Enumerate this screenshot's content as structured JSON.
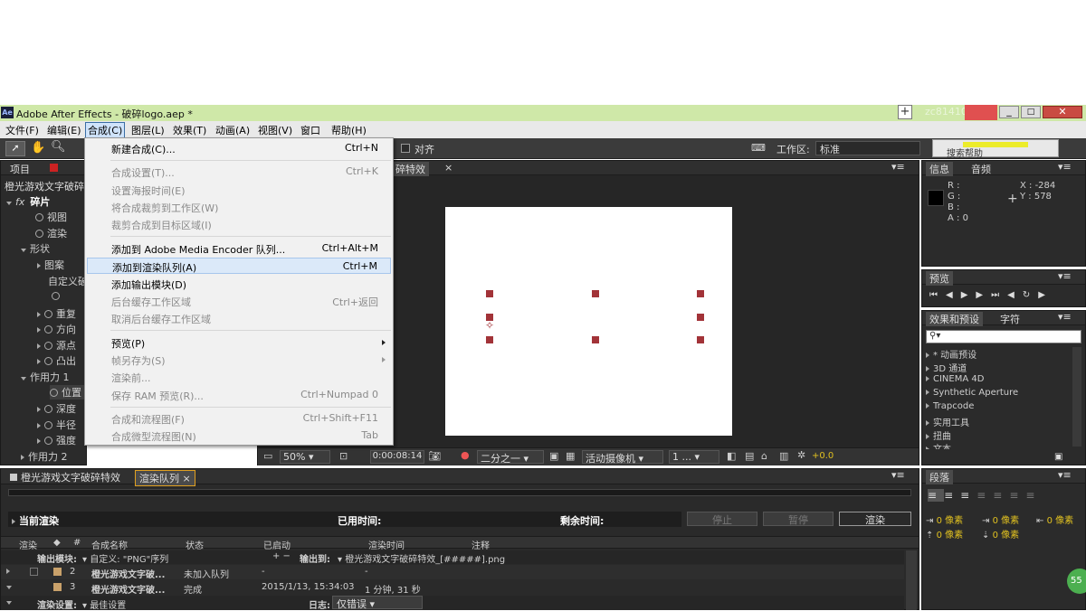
{
  "window": {
    "title": "Adobe After Effects - 破碎logo.aep *",
    "app_icon": "Ae"
  },
  "menubar": {
    "items": [
      "文件(F)",
      "编辑(E)",
      "合成(C)",
      "图层(L)",
      "效果(T)",
      "动画(A)",
      "视图(V)",
      "窗口",
      "帮助(H)"
    ]
  },
  "toolbar": {
    "align_label": "对齐",
    "workspace_label": "工作区:",
    "workspace_value": "标准",
    "search_help": "搜索帮助",
    "overlay_text": "zc81410"
  },
  "project_panel": {
    "tab": "项目",
    "comp_name": "橙光游戏文字破碎",
    "items": [
      {
        "label": "碎片",
        "kind": "fx"
      },
      {
        "label": "视图",
        "kind": "sw"
      },
      {
        "label": "渲染",
        "kind": "sw"
      },
      {
        "label": "形状",
        "kind": "open"
      },
      {
        "label": "图案",
        "kind": "sw"
      },
      {
        "label": "自定义破",
        "kind": "plain"
      },
      {
        "label": "",
        "kind": "sw"
      },
      {
        "label": "重复",
        "kind": "closed"
      },
      {
        "label": "方向",
        "kind": "closed"
      },
      {
        "label": "源点",
        "kind": "closed"
      },
      {
        "label": "凸出",
        "kind": "closed"
      },
      {
        "label": "作用力 1",
        "kind": "open"
      },
      {
        "label": "位置",
        "kind": "sw"
      },
      {
        "label": "深度",
        "kind": "closed"
      },
      {
        "label": "半径",
        "kind": "closed"
      },
      {
        "label": "强度",
        "kind": "closed"
      },
      {
        "label": "作用力 2",
        "kind": "closed"
      }
    ]
  },
  "menu": {
    "items": [
      {
        "label": "新建合成(C)...",
        "shortcut": "Ctrl+N",
        "enabled": true
      },
      {
        "sep": true
      },
      {
        "label": "合成设置(T)...",
        "shortcut": "Ctrl+K",
        "enabled": false
      },
      {
        "label": "设置海报时间(E)",
        "shortcut": "",
        "enabled": false
      },
      {
        "label": "将合成裁剪到工作区(W)",
        "shortcut": "",
        "enabled": false
      },
      {
        "label": "裁剪合成到目标区域(I)",
        "shortcut": "",
        "enabled": false
      },
      {
        "sep": true
      },
      {
        "label": "添加到 Adobe Media Encoder 队列...",
        "shortcut": "Ctrl+Alt+M",
        "enabled": true
      },
      {
        "label": "添加到渲染队列(A)",
        "shortcut": "Ctrl+M",
        "enabled": true,
        "highlight": true
      },
      {
        "label": "添加输出模块(D)",
        "shortcut": "",
        "enabled": true
      },
      {
        "label": "后台缓存工作区域",
        "shortcut": "Ctrl+返回",
        "enabled": false
      },
      {
        "label": "取消后台缓存工作区域",
        "shortcut": "",
        "enabled": false
      },
      {
        "sep": true
      },
      {
        "label": "预览(P)",
        "shortcut": "",
        "enabled": true,
        "submenu": true
      },
      {
        "label": "帧另存为(S)",
        "shortcut": "",
        "enabled": false,
        "submenu": true
      },
      {
        "label": "渲染前...",
        "shortcut": "",
        "enabled": false
      },
      {
        "label": "保存 RAM 预览(R)...",
        "shortcut": "Ctrl+Numpad 0",
        "enabled": false
      },
      {
        "sep": true
      },
      {
        "label": "合成和流程图(F)",
        "shortcut": "Ctrl+Shift+F11",
        "enabled": false
      },
      {
        "label": "合成微型流程图(N)",
        "shortcut": "Tab",
        "enabled": false
      }
    ]
  },
  "comp_viewer": {
    "tab": "碎特效",
    "zoom": "50%",
    "timecode": "0:00:08:14",
    "resolution": "二分之一",
    "camera": "活动摄像机",
    "views": "1 ...",
    "exposure": "+0.0"
  },
  "info_panel": {
    "tabs": [
      "信息",
      "音频"
    ],
    "r": "R :",
    "g": "G :",
    "b": "B :",
    "a": "A : 0",
    "x": "X : -284",
    "y": "Y : 578"
  },
  "preview_panel": {
    "tab": "预览"
  },
  "effects_panel": {
    "tabs": [
      "效果和预设",
      "字符"
    ],
    "items": [
      "* 动画预设",
      "3D 通道",
      "CINEMA 4D",
      "Synthetic Aperture",
      "Trapcode",
      "实用工具",
      "扭曲",
      "文本"
    ]
  },
  "paragraph_panel": {
    "tab": "段落",
    "field": "0 像素"
  },
  "timeline": {
    "tabs": [
      "橙光游戏文字破碎特效",
      "渲染队列"
    ],
    "current_render": "当前渲染",
    "elapsed": "已用时间:",
    "remaining": "剩余时间:",
    "buttons": [
      "停止",
      "暂停",
      "渲染"
    ],
    "columns": [
      "渲染",
      "#",
      "合成名称",
      "状态",
      "已启动",
      "渲染时间",
      "注释"
    ],
    "output_module_label": "输出模块:",
    "output_module_value": "自定义: \"PNG\"序列",
    "output_to_label": "输出到:",
    "output_to_value": "橙光游戏文字破碎特效_[#####].png",
    "rows": [
      {
        "num": "2",
        "name": "橙光游戏文字破...",
        "status": "未加入队列",
        "started": "-",
        "time": "-"
      },
      {
        "num": "3",
        "name": "橙光游戏文字破...",
        "status": "完成",
        "started": "2015/1/13, 15:34:03",
        "time": "1 分钟, 31 秒"
      }
    ],
    "render_settings_label": "渲染设置:",
    "render_settings_value": "最佳设置",
    "log_label": "日志:",
    "log_value": "仅错误"
  },
  "badge": "55"
}
